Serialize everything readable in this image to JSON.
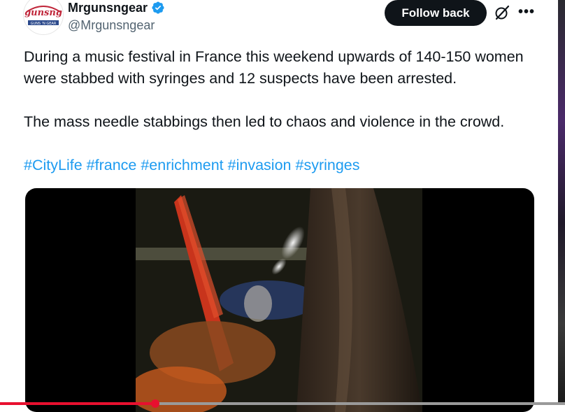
{
  "author": {
    "display_name": "Mrgunsngear",
    "handle": "@Mrgunsngear",
    "verified": true,
    "avatar_logo_text": "gunsng",
    "avatar_subtext": "GUNS 'N GEAR"
  },
  "actions": {
    "follow_label": "Follow back",
    "grok_icon": "grok-icon",
    "more_icon": "more-icon"
  },
  "tweet": {
    "paragraph1": "During a music festival in France this weekend upwards of 140-150 women were stabbed with syringes and 12 suspects have been arrested.",
    "paragraph2": "The mass needle stabbings then led to chaos and violence in the crowd.",
    "hashtags": [
      "#CityLife",
      "#france",
      "#enrichment",
      "#invasion",
      "#syringes"
    ]
  },
  "video": {
    "progress": 0.275
  },
  "colors": {
    "accent": "#1d9bf0",
    "button_bg": "#0f1419",
    "text": "#0f1419",
    "muted": "#536471",
    "progress": "#e8102f"
  }
}
